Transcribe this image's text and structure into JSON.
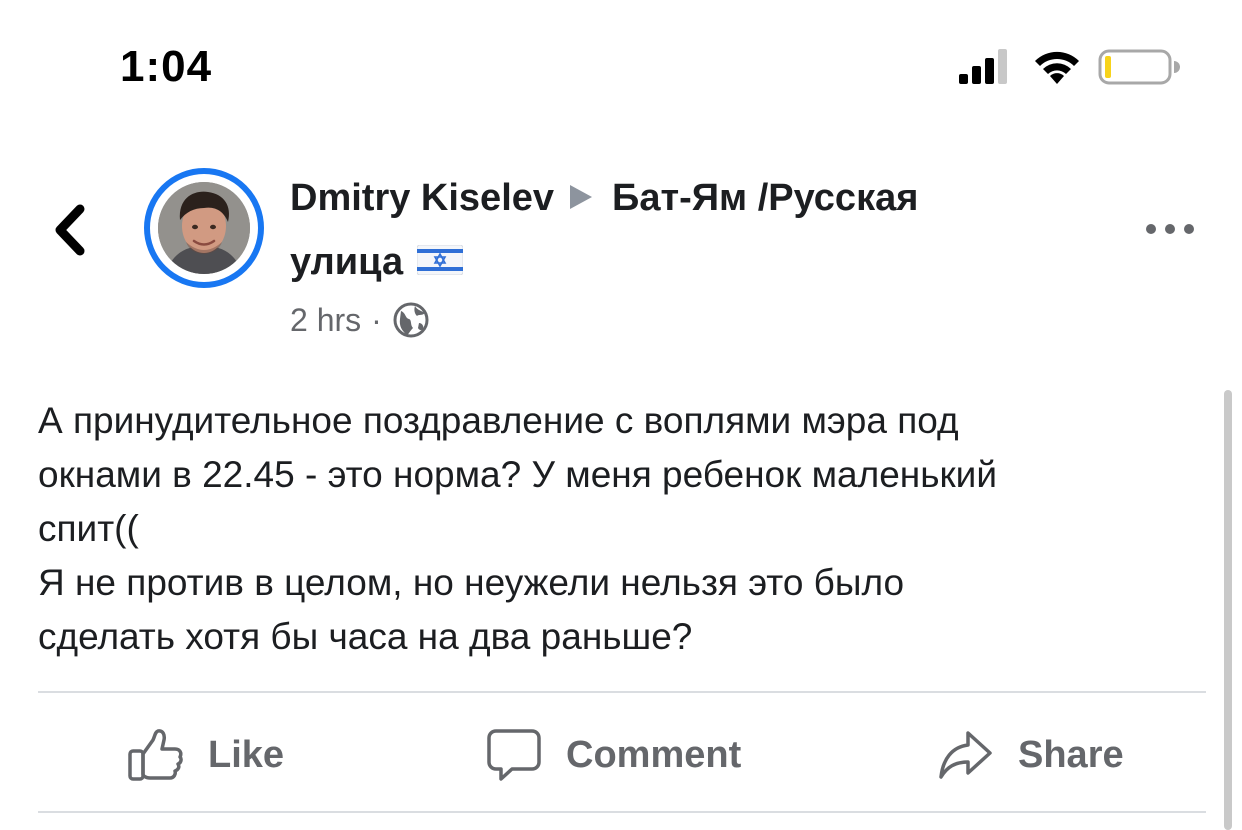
{
  "status_bar": {
    "time": "1:04",
    "icons": [
      "cellular-signal-icon",
      "wifi-icon",
      "battery-low-icon"
    ]
  },
  "post": {
    "author": "Dmitry Kiselev",
    "group_line1": "Бат-Ям /Русская",
    "group_line2": "улица",
    "flag_icon": "israel-flag-icon",
    "time_ago": "2 hrs",
    "separator": "·",
    "privacy_icon": "globe-icon",
    "text_lines": [
      "А принудительное поздравление с воплями мэра под",
      "окнами в 22.45 - это норма? У меня ребенок маленький",
      "спит((",
      "Я не против в целом, но неужели нельзя это было",
      "сделать хотя бы часа на два раньше?"
    ]
  },
  "actions": {
    "like_label": "Like",
    "comment_label": "Comment",
    "share_label": "Share"
  },
  "colors": {
    "accent": "#1877f2",
    "secondary_text": "#65676b",
    "divider": "#dadde1",
    "primary_text": "#1c1e21"
  }
}
